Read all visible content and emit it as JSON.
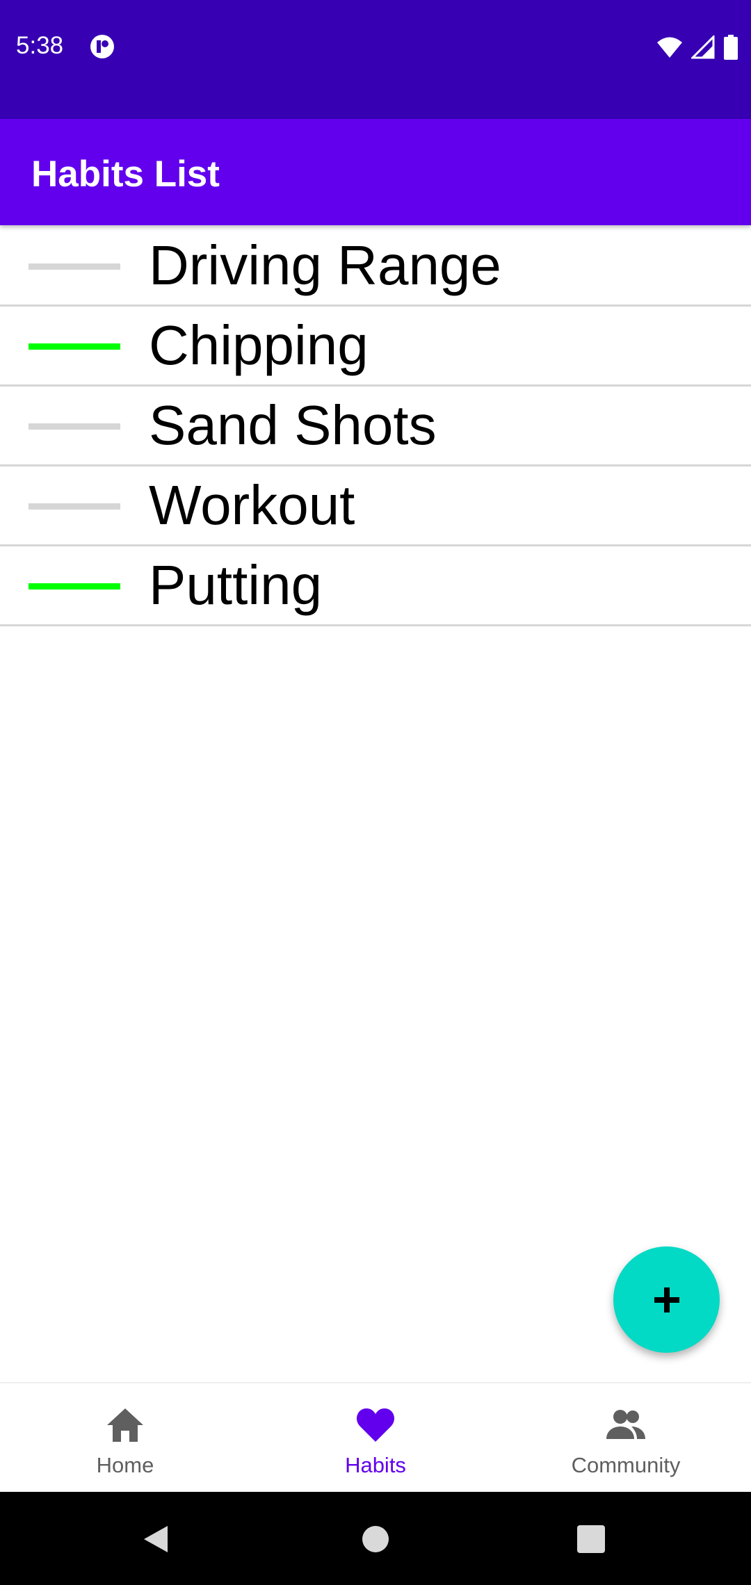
{
  "status_bar": {
    "time": "5:38"
  },
  "app_bar": {
    "title": "Habits List"
  },
  "habits": [
    {
      "label": "Driving Range",
      "indicator_color": "#d6d6d6"
    },
    {
      "label": "Chipping",
      "indicator_color": "#00ff00"
    },
    {
      "label": "Sand Shots",
      "indicator_color": "#d6d6d6"
    },
    {
      "label": "Workout",
      "indicator_color": "#d6d6d6"
    },
    {
      "label": "Putting",
      "indicator_color": "#00ff00"
    }
  ],
  "fab": {
    "icon": "plus-icon"
  },
  "bottom_nav": {
    "items": [
      {
        "label": "Home",
        "icon": "home-icon",
        "active": false
      },
      {
        "label": "Habits",
        "icon": "heart-icon",
        "active": true
      },
      {
        "label": "Community",
        "icon": "people-icon",
        "active": false
      }
    ]
  },
  "colors": {
    "status_bar": "#3700b3",
    "primary": "#6200ee",
    "accent": "#03dac5",
    "done": "#00ff00",
    "not_done": "#d6d6d6"
  }
}
